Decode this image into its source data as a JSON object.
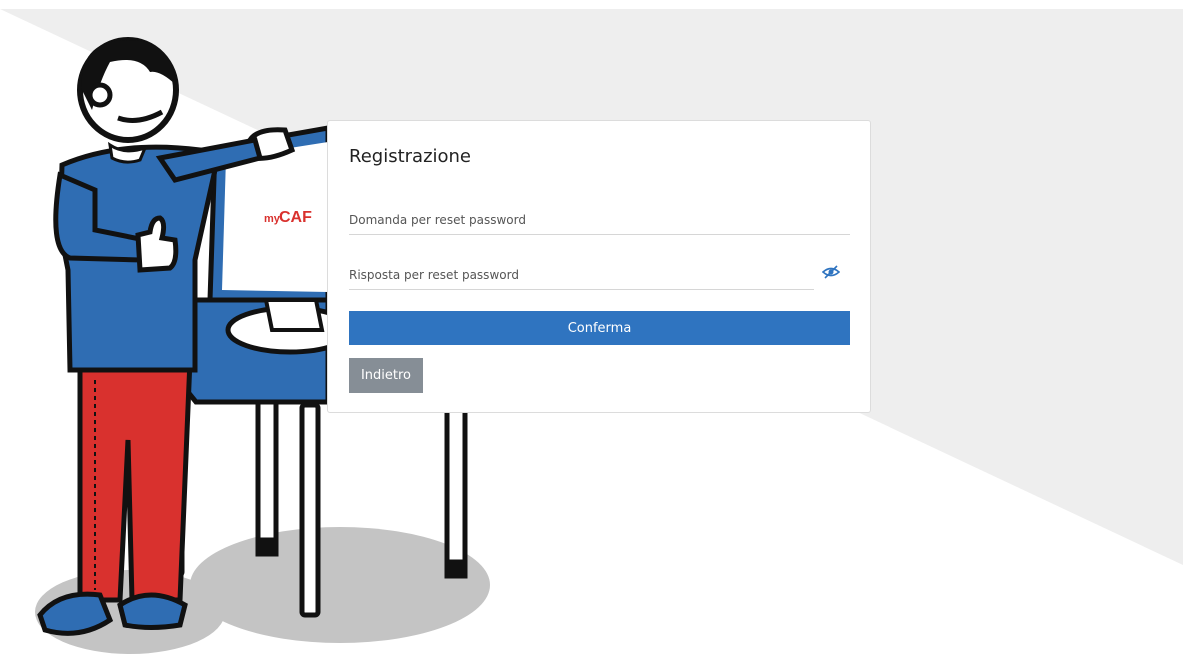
{
  "background": {
    "colors": {
      "light_gray": "#eeeeee",
      "white": "#ffffff"
    }
  },
  "illustration": {
    "screen_brand_prefix": "my",
    "screen_brand_suffix": "CAF",
    "colors": {
      "shirt": "#2f6db3",
      "pants": "#d9312e",
      "outline": "#111111",
      "shadow": "#c4c4c4",
      "screen_brand": "#d9312e"
    }
  },
  "form": {
    "title": "Registrazione",
    "question_field": {
      "placeholder": "Domanda per reset password",
      "value": ""
    },
    "answer_field": {
      "placeholder": "Risposta per reset password",
      "value": ""
    },
    "toggle_icon": "eye-slash-icon",
    "confirm_label": "Conferma",
    "back_label": "Indietro",
    "colors": {
      "primary": "#2f74c0",
      "secondary": "#868e96"
    }
  }
}
